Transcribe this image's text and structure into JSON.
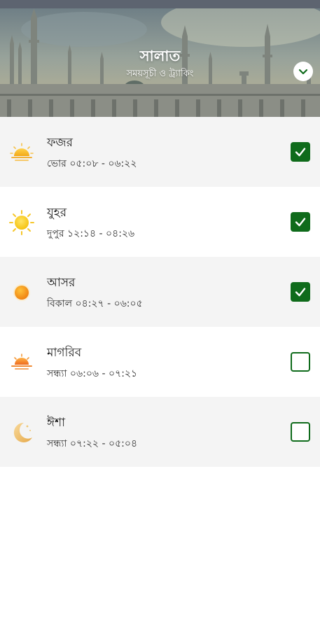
{
  "header": {
    "title": "সালাত",
    "subtitle": "সময়সূচী ও ট্র্যাকিং"
  },
  "colors": {
    "accent": "#0f6b1b",
    "row_shaded": "#f4f4f4"
  },
  "prayers": [
    {
      "name": "ফজর",
      "time": "ভোর ০৫:০৮ - ০৬:২২",
      "icon": "sunrise-icon",
      "checked": true
    },
    {
      "name": "যুহর",
      "time": "দুপুর ১২:১৪ - ০৪:২৬",
      "icon": "sun-icon",
      "checked": true
    },
    {
      "name": "আসর",
      "time": "বিকাল ০৪:২৭ - ০৬:০৫",
      "icon": "afternoon-sun-icon",
      "checked": true
    },
    {
      "name": "মাগরিব",
      "time": "সন্ধ্যা ০৬:০৬ - ০৭:২১",
      "icon": "sunset-icon",
      "checked": false
    },
    {
      "name": "ঈশা",
      "time": "সন্ধ্যা ০৭:২২ - ০৫:০৪",
      "icon": "crescent-moon-icon",
      "checked": false
    }
  ]
}
